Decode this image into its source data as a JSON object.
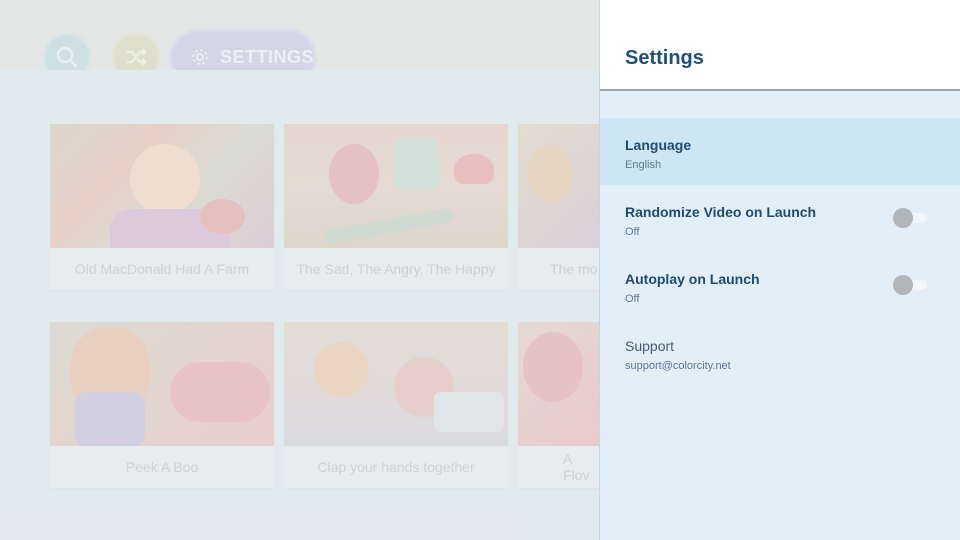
{
  "app": {
    "nav": {
      "search_icon": "search-icon",
      "shuffle_icon": "shuffle-icon",
      "settings_icon": "gear-icon",
      "settings_label": "SETTINGS"
    },
    "videos": [
      {
        "title": "Old MacDonald Had A Farm"
      },
      {
        "title": "The Sad, The Angry, The Happy"
      },
      {
        "title": "The mo"
      },
      {
        "title": "Peek A Boo"
      },
      {
        "title": "Clap your hands together"
      },
      {
        "title": "A Flov"
      }
    ]
  },
  "settings": {
    "title": "Settings",
    "rows": [
      {
        "title": "Language",
        "value": "English",
        "selected": true
      },
      {
        "title": "Randomize Video on Launch",
        "value": "Off",
        "toggle": false
      },
      {
        "title": "Autoplay on Launch",
        "value": "Off",
        "toggle": false
      },
      {
        "title": "Support",
        "value": "support@colorcity.net"
      }
    ]
  },
  "colors": {
    "panel_bg": "#e3eff8",
    "selected_row": "#cde6f3",
    "title_text": "#214f7c",
    "toggle_off": "#b3b6b9"
  }
}
